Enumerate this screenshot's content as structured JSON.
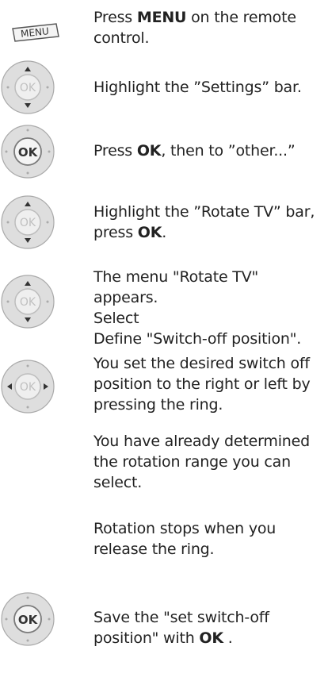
{
  "menu_key": "MENU",
  "steps": [
    {
      "pre": "Press ",
      "bold": "MENU",
      "post": " on the remote control.",
      "icon": "menu-button-icon"
    },
    {
      "text": "Highlight the ”Settings” bar.",
      "icon": "dpad-updown-icon"
    },
    {
      "pre": "Press   ",
      "bold": "OK",
      "post": ", then to ”other...”",
      "icon": "ok-button-icon"
    },
    {
      "pre": "Highlight the ”Rotate TV” bar, press ",
      "bold": "OK",
      "post": ".",
      "icon": "dpad-updown-icon"
    },
    {
      "line1": "The menu \"Rotate TV\" appears.",
      "line2": "Select",
      "line3": "Define \"Switch-off position\".",
      "icon": "dpad-updown-icon"
    },
    {
      "text": "You set the desired switch off position to the right or left by pressing the ring.",
      "icon": "dpad-leftright-icon"
    },
    {
      "text": "You have already determined the rotation range you can select."
    },
    {
      "text": "Rotation stops when you release the ring."
    },
    {
      "pre": "Save the \"set switch-off position\" with ",
      "bold": "OK",
      "post": " .",
      "icon": "ok-button-icon"
    }
  ],
  "ok_label": "OK",
  "colors": {
    "text": "#222222",
    "ring": "#d9d9d9",
    "ring_shadow": "#9a9a9a",
    "ok_face": "#efefef"
  }
}
